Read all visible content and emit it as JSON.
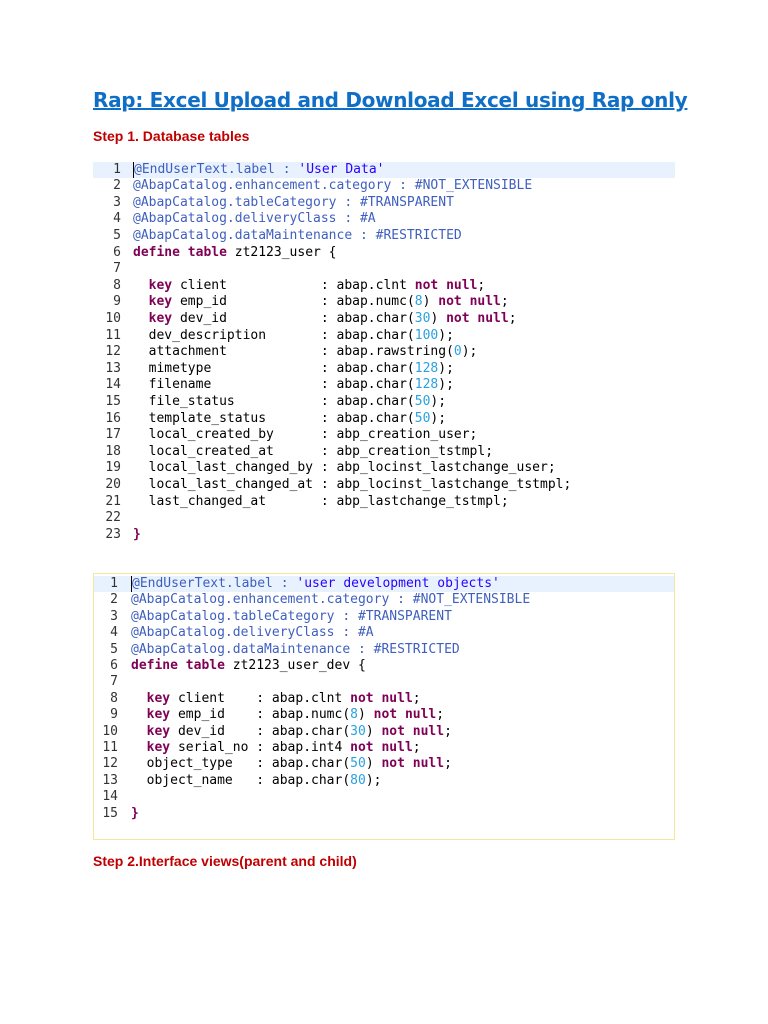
{
  "document": {
    "title": "Rap: Excel Upload and Download Excel using Rap only",
    "step1": "Step 1. Database tables",
    "step2": "Step 2.Interface views(parent and child)"
  },
  "colors": {
    "title": "#0f6fc6",
    "step_heading": "#c00000",
    "keyword": "#7f0055",
    "annotation": "#3f5fbf",
    "string": "#2a00ff",
    "number": "#2aa1e0",
    "current_line_highlight": "#e8f2fe"
  },
  "code_blocks": [
    {
      "name": "zt2123_user",
      "lines": [
        {
          "n": "1",
          "tokens": [
            [
              "an",
              "@EndUserText.label : "
            ],
            [
              "st",
              "'User Data'"
            ]
          ]
        },
        {
          "n": "2",
          "tokens": [
            [
              "an",
              "@AbapCatalog.enhancement.category : #NOT_EXTENSIBLE"
            ]
          ]
        },
        {
          "n": "3",
          "tokens": [
            [
              "an",
              "@AbapCatalog.tableCategory : #TRANSPARENT"
            ]
          ]
        },
        {
          "n": "4",
          "tokens": [
            [
              "an",
              "@AbapCatalog.deliveryClass : #A"
            ]
          ]
        },
        {
          "n": "5",
          "tokens": [
            [
              "an",
              "@AbapCatalog.dataMaintenance : #RESTRICTED"
            ]
          ]
        },
        {
          "n": "6",
          "tokens": [
            [
              "kw",
              "define table"
            ],
            [
              "",
              "zt2123_user {"
            ]
          ]
        },
        {
          "n": "7",
          "tokens": []
        },
        {
          "n": "8",
          "tokens": [
            [
              "",
              "  "
            ],
            [
              "kw",
              "key"
            ],
            [
              "",
              " client            : abap.clnt "
            ],
            [
              "kw",
              "not null"
            ],
            [
              "",
              ";"
            ]
          ]
        },
        {
          "n": "9",
          "tokens": [
            [
              "",
              "  "
            ],
            [
              "kw",
              "key"
            ],
            [
              "",
              " emp_id            : abap.numc("
            ],
            [
              "nm",
              "8"
            ],
            [
              "",
              ") "
            ],
            [
              "kw",
              "not null"
            ],
            [
              "",
              ";"
            ]
          ]
        },
        {
          "n": "10",
          "tokens": [
            [
              "",
              "  "
            ],
            [
              "kw",
              "key"
            ],
            [
              "",
              " dev_id            : abap.char("
            ],
            [
              "nm",
              "30"
            ],
            [
              "",
              ") "
            ],
            [
              "kw",
              "not null"
            ],
            [
              "",
              ";"
            ]
          ]
        },
        {
          "n": "11",
          "tokens": [
            [
              "",
              "  dev_description       : abap.char("
            ],
            [
              "nm",
              "100"
            ],
            [
              "",
              ");"
            ]
          ]
        },
        {
          "n": "12",
          "tokens": [
            [
              "",
              "  attachment            : abap.rawstring("
            ],
            [
              "nm",
              "0"
            ],
            [
              "",
              ");"
            ]
          ]
        },
        {
          "n": "13",
          "tokens": [
            [
              "",
              "  mimetype              : abap.char("
            ],
            [
              "nm",
              "128"
            ],
            [
              "",
              ");"
            ]
          ]
        },
        {
          "n": "14",
          "tokens": [
            [
              "",
              "  filename              : abap.char("
            ],
            [
              "nm",
              "128"
            ],
            [
              "",
              ");"
            ]
          ]
        },
        {
          "n": "15",
          "tokens": [
            [
              "",
              "  file_status           : abap.char("
            ],
            [
              "nm",
              "50"
            ],
            [
              "",
              ");"
            ]
          ]
        },
        {
          "n": "16",
          "tokens": [
            [
              "",
              "  template_status       : abap.char("
            ],
            [
              "nm",
              "50"
            ],
            [
              "",
              ");"
            ]
          ]
        },
        {
          "n": "17",
          "tokens": [
            [
              "",
              "  local_created_by      : abp_creation_user;"
            ]
          ]
        },
        {
          "n": "18",
          "tokens": [
            [
              "",
              "  local_created_at      : abp_creation_tstmpl;"
            ]
          ]
        },
        {
          "n": "19",
          "tokens": [
            [
              "",
              "  local_last_changed_by : abp_locinst_lastchange_user;"
            ]
          ]
        },
        {
          "n": "20",
          "tokens": [
            [
              "",
              "  local_last_changed_at : abp_locinst_lastchange_tstmpl;"
            ]
          ]
        },
        {
          "n": "21",
          "tokens": [
            [
              "",
              "  last_changed_at       : abp_lastchange_tstmpl;"
            ]
          ]
        },
        {
          "n": "22",
          "tokens": []
        },
        {
          "n": "23",
          "tokens": [
            [
              "kw",
              "}"
            ]
          ]
        }
      ]
    },
    {
      "name": "zt2123_user_dev",
      "lines": [
        {
          "n": "1",
          "tokens": [
            [
              "an",
              "@EndUserText.label : "
            ],
            [
              "st",
              "'user development objects'"
            ]
          ]
        },
        {
          "n": "2",
          "tokens": [
            [
              "an",
              "@AbapCatalog.enhancement.category : #NOT_EXTENSIBLE"
            ]
          ]
        },
        {
          "n": "3",
          "tokens": [
            [
              "an",
              "@AbapCatalog.tableCategory : #TRANSPARENT"
            ]
          ]
        },
        {
          "n": "4",
          "tokens": [
            [
              "an",
              "@AbapCatalog.deliveryClass : #A"
            ]
          ]
        },
        {
          "n": "5",
          "tokens": [
            [
              "an",
              "@AbapCatalog.dataMaintenance : #RESTRICTED"
            ]
          ]
        },
        {
          "n": "6",
          "tokens": [
            [
              "kw",
              "define table"
            ],
            [
              "",
              "zt2123_user_dev {"
            ]
          ]
        },
        {
          "n": "7",
          "tokens": []
        },
        {
          "n": "8",
          "tokens": [
            [
              "",
              "  "
            ],
            [
              "kw",
              "key"
            ],
            [
              "",
              " client    : abap.clnt "
            ],
            [
              "kw",
              "not null"
            ],
            [
              "",
              ";"
            ]
          ]
        },
        {
          "n": "9",
          "tokens": [
            [
              "",
              "  "
            ],
            [
              "kw",
              "key"
            ],
            [
              "",
              " emp_id    : abap.numc("
            ],
            [
              "nm",
              "8"
            ],
            [
              "",
              ") "
            ],
            [
              "kw",
              "not null"
            ],
            [
              "",
              ";"
            ]
          ]
        },
        {
          "n": "10",
          "tokens": [
            [
              "",
              "  "
            ],
            [
              "kw",
              "key"
            ],
            [
              "",
              " dev_id    : abap.char("
            ],
            [
              "nm",
              "30"
            ],
            [
              "",
              ") "
            ],
            [
              "kw",
              "not null"
            ],
            [
              "",
              ";"
            ]
          ]
        },
        {
          "n": "11",
          "tokens": [
            [
              "",
              "  "
            ],
            [
              "kw",
              "key"
            ],
            [
              "",
              " serial_no : abap.int4 "
            ],
            [
              "kw",
              "not null"
            ],
            [
              "",
              ";"
            ]
          ]
        },
        {
          "n": "12",
          "tokens": [
            [
              "",
              "  object_type   : abap.char("
            ],
            [
              "nm",
              "50"
            ],
            [
              "",
              ") "
            ],
            [
              "kw",
              "not null"
            ],
            [
              "",
              ";"
            ]
          ]
        },
        {
          "n": "13",
          "tokens": [
            [
              "",
              "  object_name   : abap.char("
            ],
            [
              "nm",
              "80"
            ],
            [
              "",
              ");"
            ]
          ]
        },
        {
          "n": "14",
          "tokens": []
        },
        {
          "n": "15",
          "tokens": [
            [
              "kw",
              "}"
            ]
          ]
        }
      ]
    }
  ]
}
